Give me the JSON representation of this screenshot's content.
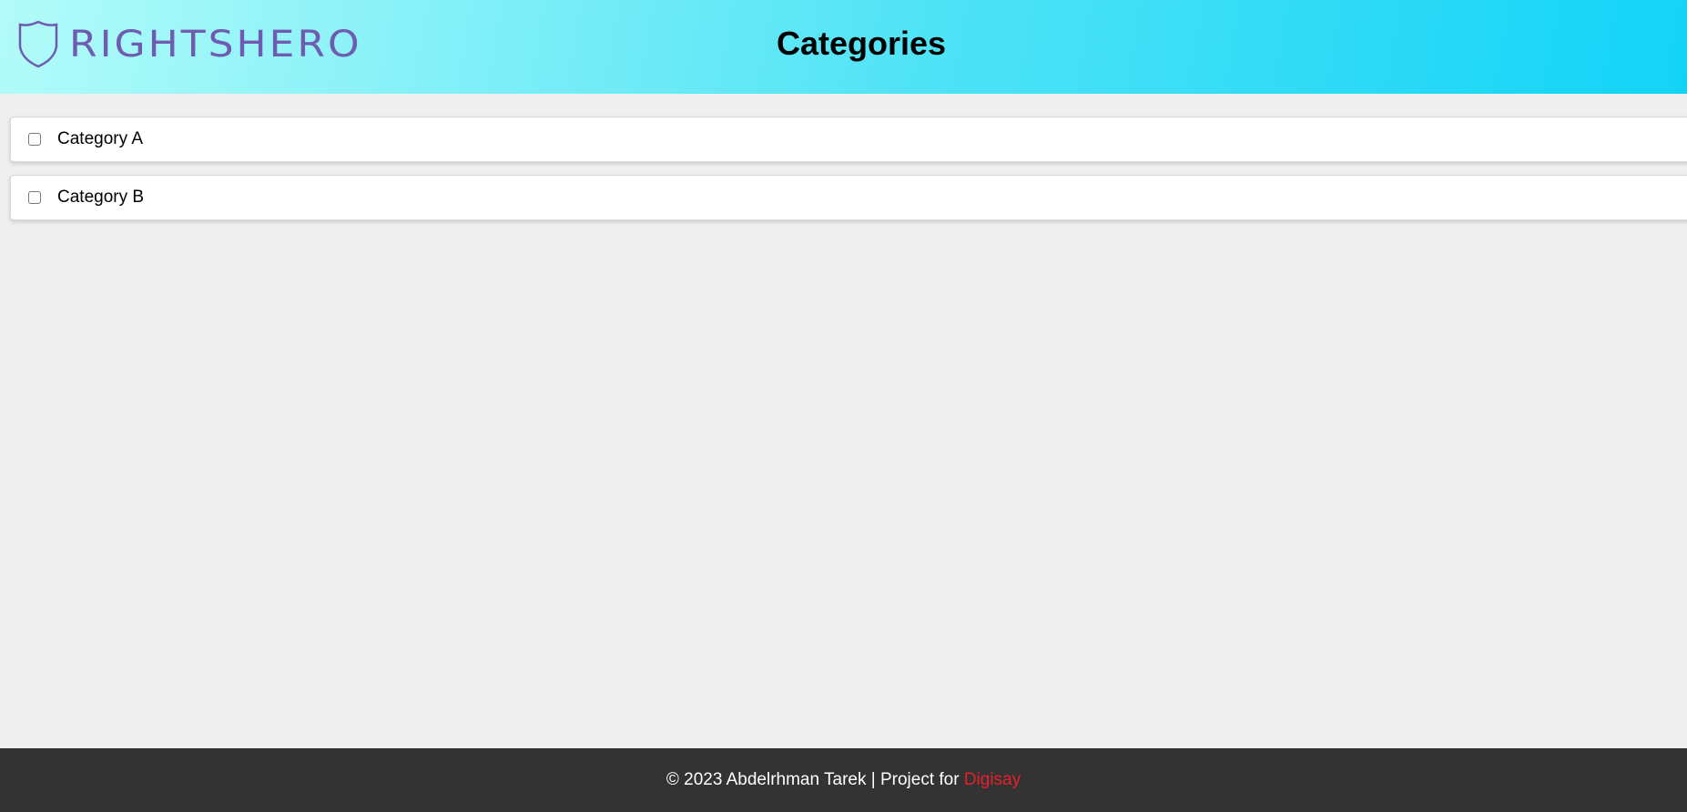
{
  "header": {
    "logo_text": "RIGHTSHERO",
    "title": "Categories"
  },
  "categories": [
    {
      "label": "Category A",
      "checked": false
    },
    {
      "label": "Category B",
      "checked": false
    }
  ],
  "footer": {
    "text": "© 2023 Abdelrhman Tarek | Project for ",
    "brand": "Digisay",
    "brand_color": "#e5202a"
  }
}
